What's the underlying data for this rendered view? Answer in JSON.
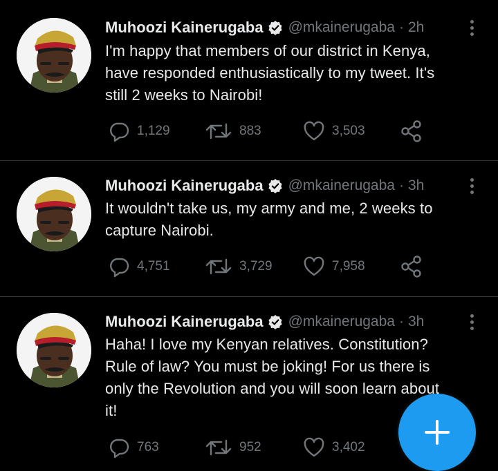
{
  "tweets": [
    {
      "name": "Muhoozi Kainerugaba",
      "handle": "@mkainerugaba",
      "separator": "·",
      "time": "2h",
      "lines": [
        "I'm happy that members of our district in Kenya,",
        "have responded enthusiastically to my tweet. It's",
        "still 2 weeks to Nairobi!"
      ],
      "replies": "1,129",
      "retweets": "883",
      "likes": "3,503"
    },
    {
      "name": "Muhoozi Kainerugaba",
      "handle": "@mkainerugaba",
      "separator": "·",
      "time": "3h",
      "lines": [
        "It wouldn't take us, my army and me, 2 weeks to",
        "capture Nairobi."
      ],
      "replies": "4,751",
      "retweets": "3,729",
      "likes": "7,958"
    },
    {
      "name": "Muhoozi Kainerugaba",
      "handle": "@mkainerugaba",
      "separator": "·",
      "time": "3h",
      "lines": [
        "Haha! I love my Kenyan relatives. Constitution?",
        "Rule of law? You must be joking! For us there is",
        "only the Revolution and you will soon learn about",
        "it!"
      ],
      "replies": "763",
      "retweets": "952",
      "likes": "3,402"
    }
  ],
  "icons": {
    "verified": "verified-badge-icon",
    "more": "more-options-icon",
    "reply": "reply-icon",
    "retweet": "retweet-icon",
    "like": "heart-icon",
    "share": "share-icon",
    "compose": "plus-icon"
  },
  "colors": {
    "background": "#000000",
    "text": "#e7e9ea",
    "muted": "#71767b",
    "divider": "#2f3336",
    "accent": "#1d9bf0"
  }
}
